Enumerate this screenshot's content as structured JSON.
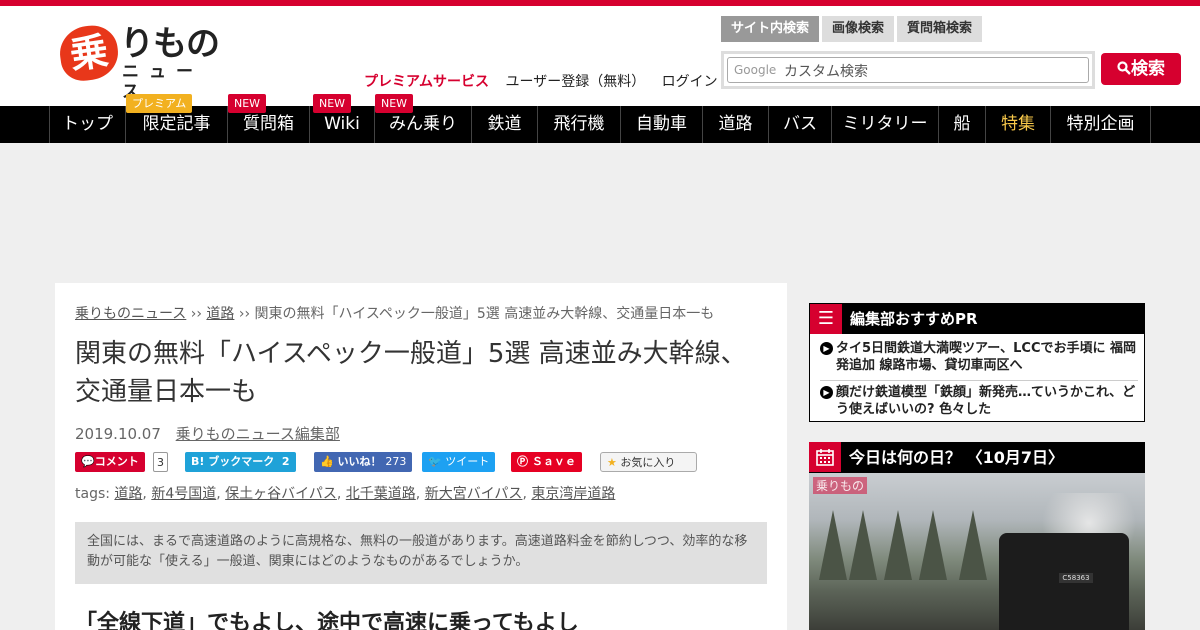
{
  "header": {
    "logo": {
      "kanji": "乗",
      "kana": "りもの",
      "news": "ニュース"
    },
    "links": {
      "premium": "プレミアムサービス",
      "register": "ユーザー登録（無料）",
      "login": "ログイン"
    },
    "search": {
      "tabs": [
        "サイト内検索",
        "画像検索",
        "質問箱検索"
      ],
      "google": "Google",
      "placeholder": "カスタム検索",
      "button": "検索"
    }
  },
  "nav": {
    "items": [
      {
        "label": "トップ"
      },
      {
        "label": "限定記事",
        "badge": "プレミアム"
      },
      {
        "label": "質問箱",
        "badge": "NEW"
      },
      {
        "label": "Wiki",
        "badge": "NEW"
      },
      {
        "label": "みん乗り",
        "badge": "NEW"
      },
      {
        "label": "鉄道"
      },
      {
        "label": "飛行機"
      },
      {
        "label": "自動車"
      },
      {
        "label": "道路"
      },
      {
        "label": "バス"
      },
      {
        "label": "ミリタリー"
      },
      {
        "label": "船"
      },
      {
        "label": "特集"
      },
      {
        "label": "特別企画"
      }
    ]
  },
  "article": {
    "breadcrumb": [
      "乗りものニュース",
      "道路",
      "関東の無料「ハイスペック一般道」5選 高速並み大幹線、交通量日本一も"
    ],
    "breadcrumb_sep": "››",
    "title": "関東の無料「ハイスペック一般道」5選 高速並み大幹線、交通量日本一も",
    "date": "2019.10.07",
    "author": "乗りものニュース編集部",
    "share": {
      "comment": "コメント",
      "comment_count": "3",
      "hatena": "B! ブックマーク",
      "hatena_count": "2",
      "like": "いいね！",
      "like_count": "273",
      "tweet": "ツイート",
      "pin": "Ｓａｖｅ",
      "fav": "お気に入り"
    },
    "tags_label": "tags:",
    "tags": [
      "道路",
      "新4号国道",
      "保土ヶ谷バイパス",
      "北千葉道路",
      "新大宮バイパス",
      "東京湾岸道路"
    ],
    "lead": "全国には、まるで高速道路のように高規格な、無料の一般道があります。高速道路料金を節約しつつ、効率的な移動が可能な「使える」一般道、関東にはどのようなものがあるでしょうか。",
    "subheading": "「全線下道」でもよし、途中で高速に乗ってもよし"
  },
  "sidebar": {
    "pr": {
      "title": "編集部おすすめPR",
      "items": [
        "タイ5日間鉄道大満喫ツアー、LCCでお手頃に 福岡発追加 線路市場、貸切車両区へ",
        "顔だけ鉄道模型「鉄顔」新発売…ていうかこれ、どう使えばいいの? 色々した"
      ]
    },
    "today": {
      "title": "今日は何の日？ 〈10月7日〉",
      "watermark": "乗りもの",
      "plate": "C58363"
    }
  },
  "colors": {
    "brand": "#d6002f",
    "premium": "#f2b120",
    "special": "#f7c84a"
  }
}
